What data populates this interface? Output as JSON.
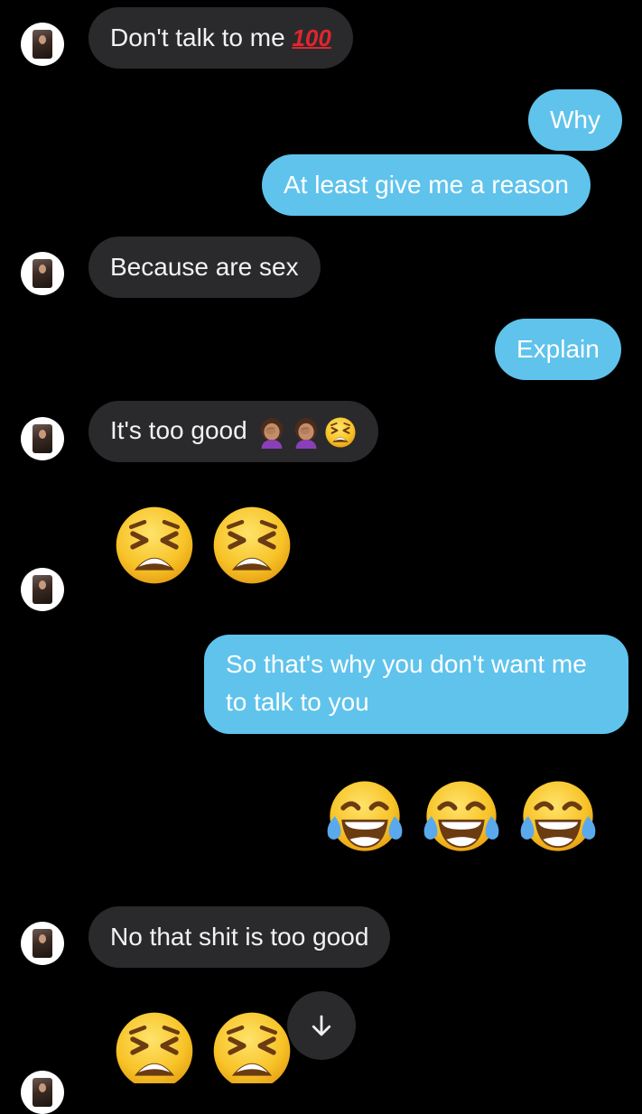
{
  "messages": [
    {
      "sender": "them",
      "text": "Don't talk to me",
      "emoji": "💯"
    },
    {
      "sender": "me",
      "text": "Why"
    },
    {
      "sender": "me",
      "text": "At least give me a reason"
    },
    {
      "sender": "them",
      "text": "Because are sex"
    },
    {
      "sender": "me",
      "text": "Explain"
    },
    {
      "sender": "them",
      "text": "It's too good",
      "emoji_names": [
        "woman-facepalming-icon",
        "woman-facepalming-icon",
        "tired-face-icon"
      ]
    },
    {
      "sender": "them",
      "emoji_only": [
        "tired-face-icon",
        "tired-face-icon"
      ]
    },
    {
      "sender": "me",
      "text": "So that's why you don't want me to talk to you"
    },
    {
      "sender": "me",
      "emoji_only": [
        "face-with-tears-of-joy-icon",
        "face-with-tears-of-joy-icon",
        "face-with-tears-of-joy-icon"
      ]
    },
    {
      "sender": "them",
      "text": "No that shit is too good"
    },
    {
      "sender": "them",
      "emoji_only": [
        "tired-face-icon",
        "tired-face-icon"
      ]
    }
  ],
  "hundred_emoji": "100",
  "scroll_down_icon": "arrow-down-icon",
  "colors": {
    "background": "#000000",
    "incoming_bubble": "#2a2a2c",
    "outgoing_bubble": "#5fc3ec",
    "text": "#ffffff"
  }
}
